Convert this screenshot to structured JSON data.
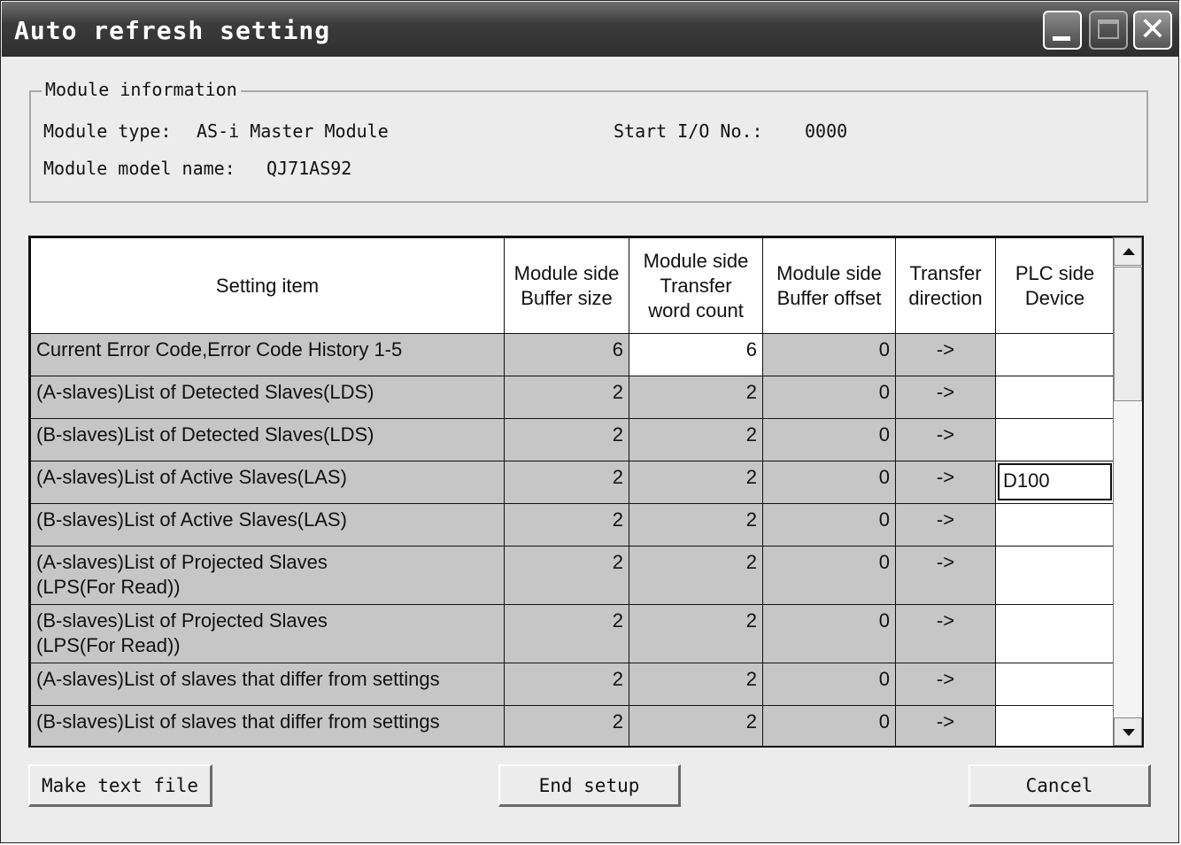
{
  "window": {
    "title": "Auto refresh setting",
    "controls": {
      "minimize_icon": "minimize-icon",
      "maximize_icon": "maximize-icon",
      "close_icon": "close-icon"
    }
  },
  "module_info": {
    "legend": "Module information",
    "type_label": "Module type:",
    "type_value": "AS-i Master Module",
    "start_io_label": "Start I/O No.:",
    "start_io_value": "0000",
    "model_label": "Module model name:",
    "model_value": "QJ71AS92"
  },
  "table": {
    "headers": [
      "Setting item",
      "Module side\nBuffer size",
      "Module side\nTransfer\nword count",
      "Module side\nBuffer offset",
      "Transfer\ndirection",
      "PLC side\nDevice"
    ],
    "rows": [
      {
        "item": "Current Error Code,Error Code History 1-5",
        "buffer_size": "6",
        "word_count": "6",
        "offset": "0",
        "direction": "->",
        "device": ""
      },
      {
        "item": "(A-slaves)List of Detected Slaves(LDS)",
        "buffer_size": "2",
        "word_count": "2",
        "offset": "0",
        "direction": "->",
        "device": ""
      },
      {
        "item": "(B-slaves)List of Detected Slaves(LDS)",
        "buffer_size": "2",
        "word_count": "2",
        "offset": "0",
        "direction": "->",
        "device": ""
      },
      {
        "item": "(A-slaves)List of Active Slaves(LAS)",
        "buffer_size": "2",
        "word_count": "2",
        "offset": "0",
        "direction": "->",
        "device": "D100"
      },
      {
        "item": "(B-slaves)List of Active Slaves(LAS)",
        "buffer_size": "2",
        "word_count": "2",
        "offset": "0",
        "direction": "->",
        "device": ""
      },
      {
        "item": "(A-slaves)List of Projected Slaves\n(LPS(For Read))",
        "buffer_size": "2",
        "word_count": "2",
        "offset": "0",
        "direction": "->",
        "device": ""
      },
      {
        "item": "(B-slaves)List of Projected Slaves\n(LPS(For Read))",
        "buffer_size": "2",
        "word_count": "2",
        "offset": "0",
        "direction": "->",
        "device": ""
      },
      {
        "item": "(A-slaves)List of slaves that differ from settings",
        "buffer_size": "2",
        "word_count": "2",
        "offset": "0",
        "direction": "->",
        "device": ""
      },
      {
        "item": "(B-slaves)List of slaves that differ from settings",
        "buffer_size": "2",
        "word_count": "2",
        "offset": "0",
        "direction": "->",
        "device": ""
      }
    ]
  },
  "buttons": {
    "make_text_file": "Make text file",
    "end_setup": "End setup",
    "cancel": "Cancel"
  }
}
